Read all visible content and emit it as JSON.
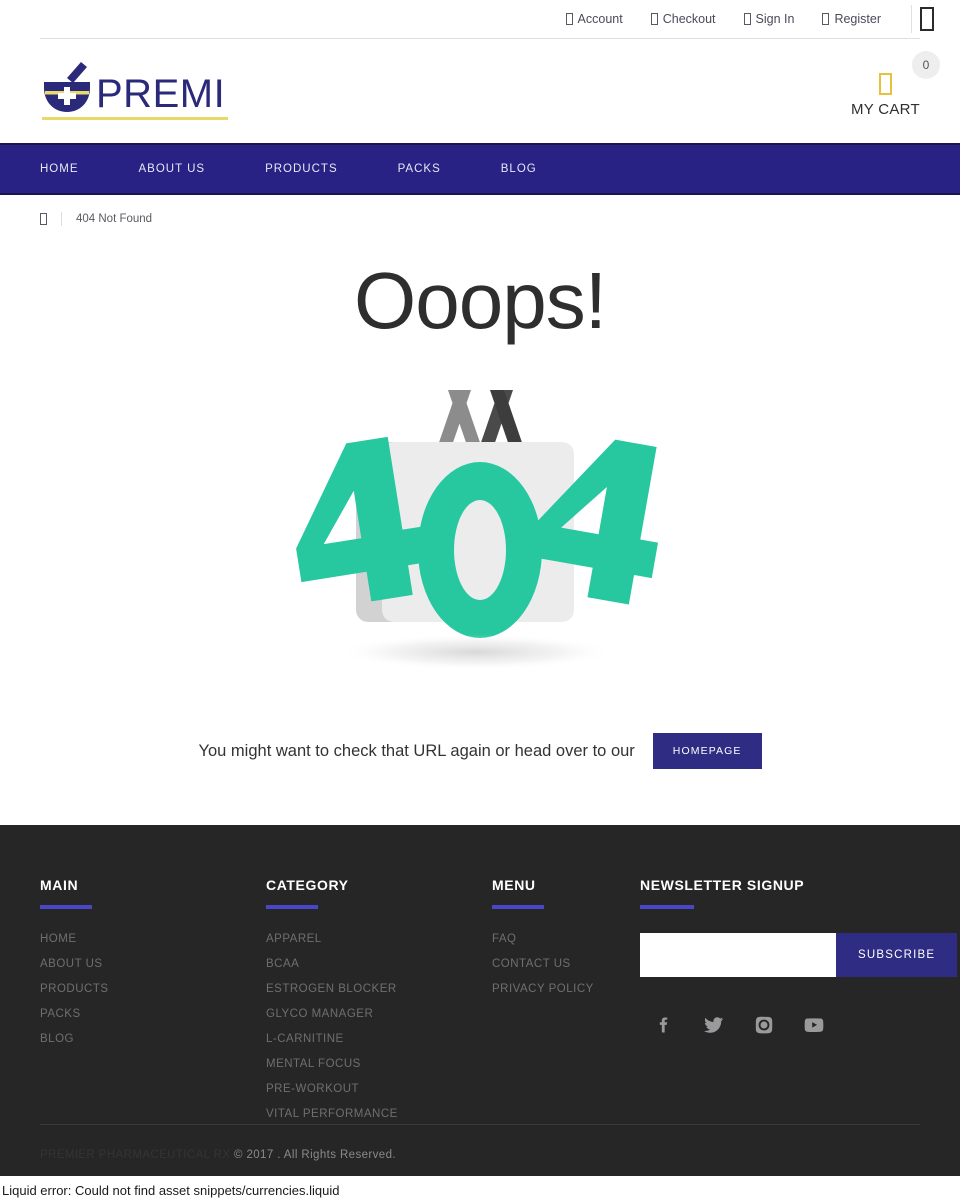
{
  "topbar": {
    "links": [
      {
        "label": "Account",
        "icon": "user-icon"
      },
      {
        "label": "Checkout",
        "icon": "cart-icon"
      },
      {
        "label": "Sign In",
        "icon": "signin-icon"
      },
      {
        "label": "Register",
        "icon": "register-icon"
      }
    ],
    "menu_icon": "missing-glyph-icon"
  },
  "header": {
    "logo_text": "PREMIER",
    "cart": {
      "count": "0",
      "label": "MY CART",
      "icon": "shopping-cart-icon"
    }
  },
  "nav": {
    "items": [
      {
        "label": "HOME"
      },
      {
        "label": "ABOUT US"
      },
      {
        "label": "PRODUCTS"
      },
      {
        "label": "PACKS"
      },
      {
        "label": "BLOG"
      }
    ]
  },
  "breadcrumb": {
    "home_icon": "home-icon",
    "current": "404 Not Found"
  },
  "main": {
    "heading": "Ooops!",
    "graphic": "404-shopping-bag-illustration",
    "graphic_digits": "404",
    "cta_text": "You might want to check that URL again or head over to our",
    "cta_button": "HOMEPAGE"
  },
  "footer": {
    "columns": [
      {
        "title": "MAIN",
        "links": [
          {
            "label": "HOME"
          },
          {
            "label": "ABOUT US"
          },
          {
            "label": "PRODUCTS"
          },
          {
            "label": "PACKS"
          },
          {
            "label": "BLOG"
          }
        ]
      },
      {
        "title": "CATEGORY",
        "links": [
          {
            "label": "APPAREL"
          },
          {
            "label": "BCAA"
          },
          {
            "label": "ESTROGEN BLOCKER"
          },
          {
            "label": "GLYCO MANAGER"
          },
          {
            "label": "L-CARNITINE"
          },
          {
            "label": "MENTAL FOCUS"
          },
          {
            "label": "PRE-WORKOUT"
          },
          {
            "label": "VITAL PERFORMANCE"
          }
        ]
      },
      {
        "title": "MENU",
        "links": [
          {
            "label": "FAQ"
          },
          {
            "label": "CONTACT US"
          },
          {
            "label": "PRIVACY POLICY"
          }
        ]
      }
    ],
    "newsletter": {
      "title": "NEWSLETTER SIGNUP",
      "input_value": "",
      "input_placeholder": "",
      "button": "SUBSCRIBE"
    },
    "socials": [
      {
        "name": "facebook-icon"
      },
      {
        "name": "twitter-icon"
      },
      {
        "name": "instagram-icon"
      },
      {
        "name": "youtube-icon"
      }
    ],
    "copyright_brand": "PREMIER PHARMACEUTICAL RX",
    "copyright_rest": " © 2017 . All Rights Reserved."
  },
  "liquid_error": "Liquid error: Could not find asset snippets/currencies.liquid",
  "colors": {
    "nav_navy": "#272283",
    "accent_purple": "#4a46c8",
    "teal_404": "#27c8a0",
    "cart_gold": "#e8c13c",
    "footer_bg": "#262626",
    "logo_navy": "#2b2a7a",
    "logo_gold": "#e8d96a"
  }
}
